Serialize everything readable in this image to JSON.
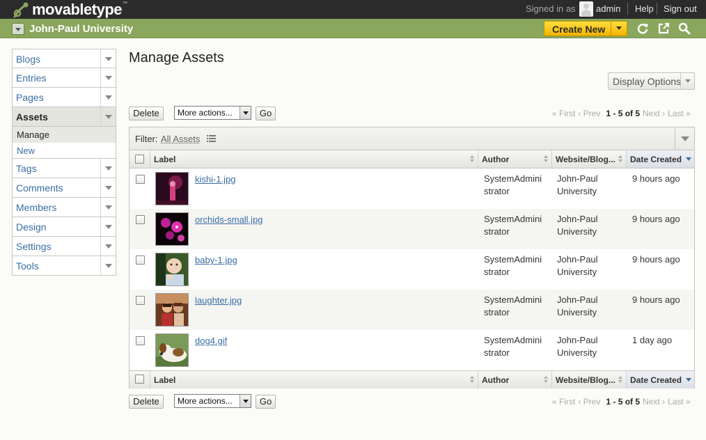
{
  "topbar": {
    "brand": "movabletype",
    "brand_mark": "™",
    "signed_in_as": "Signed in as",
    "user": "admin",
    "help": "Help",
    "sign_out": "Sign out"
  },
  "site_bar": {
    "site_name": "John-Paul University",
    "create_new": "Create New",
    "icons": [
      "refresh-icon",
      "external-link-icon",
      "search-icon"
    ]
  },
  "sidebar": {
    "items": [
      {
        "label": "Blogs"
      },
      {
        "label": "Entries"
      },
      {
        "label": "Pages"
      },
      {
        "label": "Assets"
      },
      {
        "label": "Tags"
      },
      {
        "label": "Comments"
      },
      {
        "label": "Members"
      },
      {
        "label": "Design"
      },
      {
        "label": "Settings"
      },
      {
        "label": "Tools"
      }
    ],
    "assets_sub": [
      {
        "label": "Manage"
      },
      {
        "label": "New"
      }
    ]
  },
  "main": {
    "title": "Manage Assets",
    "display_options": "Display Options",
    "delete": "Delete",
    "more_actions": "More actions...",
    "go": "Go",
    "pager": {
      "first": "« First",
      "prev": "‹ Prev",
      "count": "1 - 5 of 5",
      "next": "Next ›",
      "last": "Last »"
    },
    "filter": {
      "label": "Filter:",
      "value": "All Assets"
    },
    "columns": {
      "label": "Label",
      "author": "Author",
      "website": "Website/Blog...",
      "date": "Date Created"
    },
    "rows": [
      {
        "file": "kishi-1.jpg",
        "author_1": "SystemAdmini",
        "author_2": "strator",
        "site_1": "John-Paul",
        "site_2": "University",
        "date": "9 hours ago"
      },
      {
        "file": "orchids-small.jpg",
        "author_1": "SystemAdmini",
        "author_2": "strator",
        "site_1": "John-Paul",
        "site_2": "University",
        "date": "9 hours ago"
      },
      {
        "file": "baby-1.jpg",
        "author_1": "SystemAdmini",
        "author_2": "strator",
        "site_1": "John-Paul",
        "site_2": "University",
        "date": "9 hours ago"
      },
      {
        "file": "laughter.jpg",
        "author_1": "SystemAdmini",
        "author_2": "strator",
        "site_1": "John-Paul",
        "site_2": "University",
        "date": "9 hours ago"
      },
      {
        "file": "dog4.gif",
        "author_1": "SystemAdmini",
        "author_2": "strator",
        "site_1": "John-Paul",
        "site_2": "University",
        "date": "1 day ago"
      }
    ]
  },
  "colors": {
    "topbar": "#2b2b2b",
    "site_bar": "#8ba65d",
    "create_button": "#f2b400",
    "link": "#3a6ea5"
  }
}
